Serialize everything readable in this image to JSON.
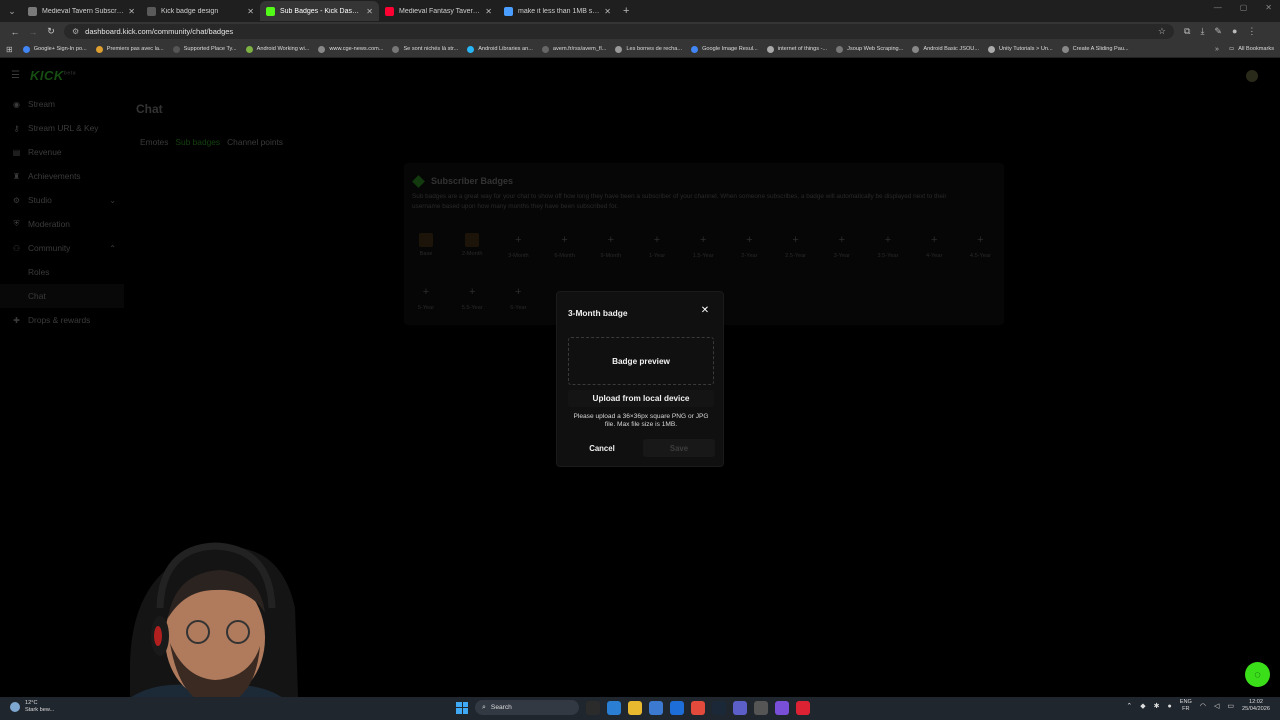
{
  "browser": {
    "tabs": [
      {
        "title": "Medieval Tavern Subscriber Ba...",
        "color": "#7a7a7a",
        "active": false
      },
      {
        "title": "Kick badge design",
        "color": "#5a5a5a",
        "active": false
      },
      {
        "title": "Sub Badges - Kick Dashboard",
        "color": "#53fc18",
        "active": true
      },
      {
        "title": "Medieval Fantasy Tavern 3 ...",
        "color": "#ff0033",
        "active": false
      },
      {
        "title": "make it less than 1MB size - Gr...",
        "color": "#4a9eff",
        "active": false
      }
    ],
    "url": "dashboard.kick.com/community/chat/badges",
    "bookmarks": [
      "Google+ Sign-In po...",
      "Premiers pas avec la...",
      "Supported Place Ty...",
      "Android Working wi...",
      "www.cge-news.com...",
      "Se sont nichés là str...",
      "Android Libraries an...",
      "avem.fr/rss/avem_fl...",
      "Les bornes de recha...",
      "Google Image Resul...",
      "internet of things -...",
      "Jsoup Web Scraping...",
      "Android Basic JSOU...",
      "Unity Tutorials > Un...",
      "Create A Sliding Pau..."
    ],
    "all_bookmarks": "All Bookmarks"
  },
  "app": {
    "logo": "KICK",
    "logo_sup": "beta",
    "sidebar": [
      {
        "label": "Stream",
        "icon": "radio-icon"
      },
      {
        "label": "Stream URL & Key",
        "icon": "key-icon"
      },
      {
        "label": "Revenue",
        "icon": "wallet-icon"
      },
      {
        "label": "Achievements",
        "icon": "trophy-icon"
      },
      {
        "label": "Studio",
        "icon": "gear-icon",
        "chevron": "⌄"
      },
      {
        "label": "Moderation",
        "icon": "shield-icon"
      },
      {
        "label": "Community",
        "icon": "users-icon",
        "chevron": "⌃"
      },
      {
        "label": "Roles",
        "sub": true
      },
      {
        "label": "Chat",
        "sub": true,
        "selected": true
      },
      {
        "label": "Drops & rewards",
        "icon": "gift-icon"
      }
    ],
    "page_title": "Chat",
    "subtabs": [
      "Emotes",
      "Sub badges",
      "Channel points"
    ],
    "badges_card": {
      "title": "Subscriber Badges",
      "description": "Sub badges are a great way for your chat to show off how long they have been a subscriber of your channel. When someone subscribes, a badge will automatically be displayed next to their username based upon how many months they have been subscribed for.",
      "slots_row1": [
        "Base",
        "2-Month",
        "3-Month",
        "6-Month",
        "9-Month",
        "1-Year",
        "1.5-Year",
        "2-Year",
        "2.5-Year",
        "3-Year",
        "3.5-Year",
        "4-Year",
        "4.5-Year"
      ],
      "slots_row2": [
        "5-Year",
        "5.5-Year",
        "6-Year"
      ]
    }
  },
  "modal": {
    "title": "3-Month badge",
    "preview": "Badge preview",
    "upload": "Upload from local device",
    "hint": "Please upload a 36×36px square PNG or JPG file. Max file size is 1MB.",
    "cancel": "Cancel",
    "save": "Save"
  },
  "taskbar": {
    "weather_temp": "12°C",
    "weather_desc": "Stark bew...",
    "search": "Search",
    "lang1": "ENG",
    "lang2": "FR",
    "time": "12:02",
    "date": "25/04/2026"
  }
}
